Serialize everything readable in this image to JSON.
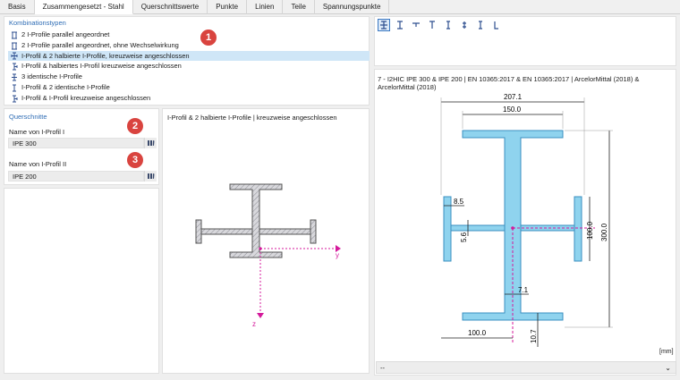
{
  "tabs": [
    "Basis",
    "Zusammengesetzt - Stahl",
    "Querschnittswerte",
    "Punkte",
    "Linien",
    "Teile",
    "Spannungspunkte"
  ],
  "combination": {
    "title": "Kombinationstypen",
    "items": [
      {
        "label": "2 I-Profile parallel angeordnet",
        "icon": "two-i-parallel-icon"
      },
      {
        "label": "2 I-Profile parallel angeordnet, ohne Wechselwirkung",
        "icon": "two-i-parallel-no-interaction-icon"
      },
      {
        "label": "I-Profil & 2 halbierte I-Profile, kreuzweise angeschlossen",
        "icon": "i-cross-halves-icon",
        "selected": true
      },
      {
        "label": "I-Profil & halbiertes I-Profil kreuzweise angeschlossen",
        "icon": "i-cross-half-icon"
      },
      {
        "label": "3 identische I-Profile",
        "icon": "three-i-icon"
      },
      {
        "label": "I-Profil & 2 identische I-Profile",
        "icon": "i-two-identical-icon"
      },
      {
        "label": "I-Profil & I-Profil kreuzweise angeschlossen",
        "icon": "i-i-cross-icon"
      }
    ]
  },
  "sections": {
    "title": "Querschnitte",
    "profile1_label": "Name von I-Profil I",
    "profile1_value": "IPE 300",
    "profile2_label": "Name von I-Profil II",
    "profile2_value": "IPE 200"
  },
  "badges": [
    "1",
    "2",
    "3"
  ],
  "preview": {
    "title": "I-Profil & 2 halbierte I-Profile | kreuzweise angeschlossen",
    "axis_y": "y",
    "axis_z": "z"
  },
  "drawing": {
    "description": "7 - I2HIC IPE 300 & IPE 200 | EN 10365:2017 & EN 10365:2017 | ArcelorMittal (2018) & ArcelorMittal (2018)",
    "dims": {
      "d_207": "207.1",
      "d_150": "150.0",
      "d_85": "8.5",
      "d_56": "5.6",
      "d_100v": "100.0",
      "d_300": "300.0",
      "d_71": "7.1",
      "d_100h": "100.0",
      "d_107": "10.7"
    },
    "unit": "[mm]",
    "dropdown_value": "--"
  },
  "colors": {
    "accent": "#2f6db5",
    "section_fill": "#8fd3ee",
    "section_stroke": "#3a8fc0",
    "badge": "#d9443f",
    "axis": "#d4199b",
    "hatch_fill": "#d8d8dc"
  }
}
